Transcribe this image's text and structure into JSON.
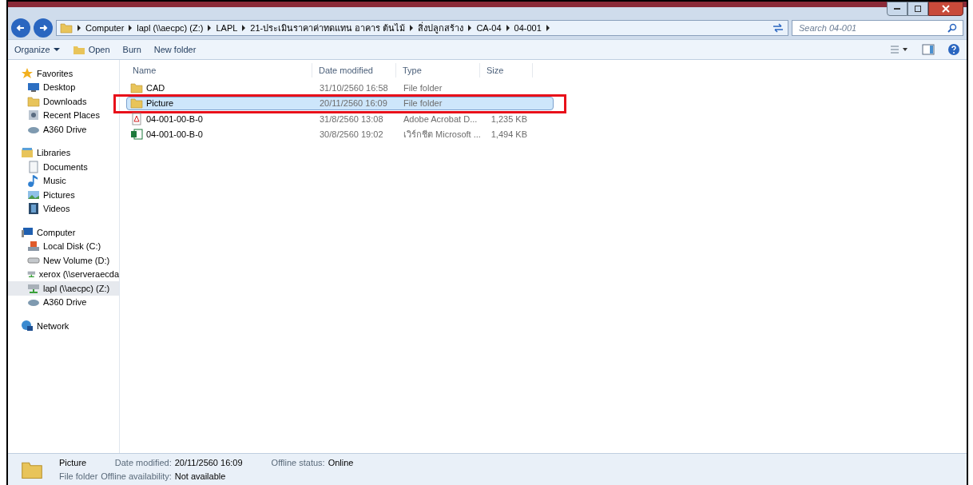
{
  "address_bar": {
    "segments": [
      "Computer",
      "lapl (\\\\aecpc) (Z:)",
      "LAPL",
      "21-ประเมินราคาค่าทดแทน อาคาร ต้นไม้",
      "สิ่งปลูกสร้าง",
      "CA-04",
      "04-001"
    ]
  },
  "search": {
    "placeholder": "Search 04-001"
  },
  "toolbar": {
    "buttons": [
      {
        "label": "Organize",
        "kind": "menu"
      },
      {
        "label": "Open",
        "kind": "icon"
      },
      {
        "label": "Burn",
        "kind": "plain"
      },
      {
        "label": "New folder",
        "kind": "plain"
      }
    ]
  },
  "sidebar": {
    "groups": [
      {
        "label": "Favorites",
        "kind": "star",
        "items": [
          {
            "label": "Desktop",
            "kind": "desktop",
            "selected": false
          },
          {
            "label": "Downloads",
            "kind": "folder",
            "selected": false
          },
          {
            "label": "Recent Places",
            "kind": "recent",
            "selected": false
          },
          {
            "label": "A360 Drive",
            "kind": "cloud",
            "selected": false
          }
        ]
      },
      {
        "label": "Libraries",
        "kind": "library",
        "items": [
          {
            "label": "Documents",
            "kind": "doc",
            "selected": false
          },
          {
            "label": "Music",
            "kind": "music",
            "selected": false
          },
          {
            "label": "Pictures",
            "kind": "pictures",
            "selected": false
          },
          {
            "label": "Videos",
            "kind": "video",
            "selected": false
          }
        ]
      },
      {
        "label": "Computer",
        "kind": "computer",
        "items": [
          {
            "label": "Local Disk (C:)",
            "kind": "disk",
            "selected": false
          },
          {
            "label": "New Volume (D:)",
            "kind": "drive",
            "selected": false
          },
          {
            "label": "xerox (\\\\serveraecda",
            "kind": "net",
            "selected": false
          },
          {
            "label": "lapl (\\\\aecpc) (Z:)",
            "kind": "net",
            "selected": true
          },
          {
            "label": "A360 Drive",
            "kind": "cloud",
            "selected": false
          }
        ]
      },
      {
        "label": "Network",
        "kind": "network"
      }
    ]
  },
  "table": {
    "columns": [
      "Name",
      "Date modified",
      "Type",
      "Size"
    ],
    "rows": [
      {
        "name": "CAD",
        "date": "31/10/2560 16:58",
        "type": "File folder",
        "size": "",
        "kind": "folder",
        "selected": false,
        "marked": false
      },
      {
        "name": "Picture",
        "date": "20/11/2560 16:09",
        "type": "File folder",
        "size": "",
        "kind": "folder",
        "selected": true,
        "marked": true
      },
      {
        "name": "04-001-00-B-0",
        "date": "31/8/2560 13:08",
        "type": "Adobe Acrobat D...",
        "size": "1,235 KB",
        "kind": "pdf",
        "selected": false,
        "marked": false
      },
      {
        "name": "04-001-00-B-0",
        "date": "30/8/2560 19:02",
        "type": "เวิร์กชีต Microsoft ...",
        "size": "1,494 KB",
        "kind": "excel",
        "selected": false,
        "marked": false
      }
    ]
  },
  "details": {
    "name": "Picture",
    "type": "File folder",
    "fields": [
      {
        "label": "Date modified:",
        "value": "20/11/2560 16:09"
      },
      {
        "label": "Offline status:",
        "value": "Online"
      },
      {
        "label": "Offline availability:",
        "value": "Not available"
      }
    ]
  }
}
